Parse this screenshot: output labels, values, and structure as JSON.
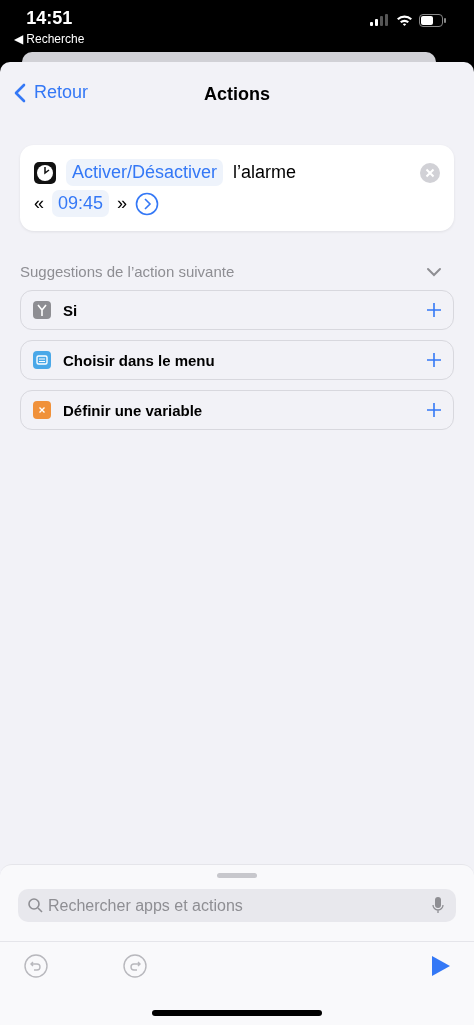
{
  "status_bar": {
    "time": "14:51",
    "back_app": "◀ Recherche"
  },
  "nav": {
    "back": "Retour",
    "title": "Actions"
  },
  "action_card": {
    "verb": "Activer/Désactiver",
    "object": "l’alarme",
    "open_quote": "«",
    "value": "09:45",
    "close_quote": "»"
  },
  "suggestions": {
    "title": "Suggestions de l’action suivante",
    "expanded": true,
    "items": [
      {
        "label": "Si",
        "kind": "if"
      },
      {
        "label": "Choisir dans le menu",
        "kind": "menu"
      },
      {
        "label": "Définir une variable",
        "kind": "variable"
      }
    ]
  },
  "search": {
    "placeholder": "Rechercher apps et actions"
  },
  "toolbar": {
    "undo_disabled": true,
    "redo_disabled": true
  }
}
